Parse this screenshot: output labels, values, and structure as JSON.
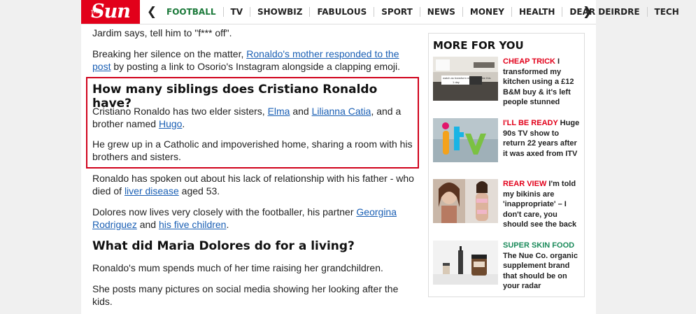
{
  "brand": {
    "logo_text": "Sun",
    "logo_small": "THE"
  },
  "nav": {
    "items": [
      "FOOTBALL",
      "TV",
      "SHOWBIZ",
      "FABULOUS",
      "SPORT",
      "NEWS",
      "MONEY",
      "HEALTH",
      "DEAR DEIRDRE",
      "TECH"
    ],
    "active_color": "#1c7a3b"
  },
  "article": {
    "p1": "Jardim says, tell him to \"f*** off\".",
    "p2": {
      "pre": "Breaking her silence on the matter, ",
      "link": "Ronaldo's mother responded to the post",
      "post": " by posting a link to Osorio's Instagram alongside a clapping emoji."
    },
    "h_siblings": "How many siblings does Cristiano Ronaldo have?",
    "p3": {
      "a": "Cristiano Ronaldo has two elder sisters, ",
      "link1": "Elma",
      "b": " and ",
      "link2": "Lilianna Catia",
      "c": ", and a brother named ",
      "link3": "Hugo",
      "d": "."
    },
    "p4": "He grew up in a Catholic and impoverished home, sharing a room with his brothers and sisters.",
    "p5": {
      "a": "Ronaldo has spoken out about his lack of relationship with his father - who died of ",
      "link": "liver disease",
      "b": " aged 53."
    },
    "p6": {
      "a": "Dolores now lives very closely with the footballer, his partner ",
      "link1": "Georgina Rodriguez",
      "b": " and ",
      "link2": "his five children",
      "c": "."
    },
    "h_living": "What did Maria Dolores do for a living?",
    "p7": "Ronaldo's mum spends much of her time raising her grandchildren.",
    "p8": "She posts many pictures on social media showing her looking after the kids."
  },
  "sidebar": {
    "title": "MORE FOR YOU",
    "cards": [
      {
        "kicker": "CHEAP TRICK",
        "kicker_color": "#e2001a",
        "text": " I transformed my kitchen using a £12 B&M buy & it's left people stunned",
        "thumb_icon": "kitchen-photo",
        "thumb_caption": "watch as transform my kitchen like this",
        "thumb_caption2": "1 day"
      },
      {
        "kicker": "I'LL BE READY",
        "kicker_color": "#e2001a",
        "text": " Huge 90s TV show to return 22 years after it was axed from ITV",
        "thumb_icon": "itv-logo"
      },
      {
        "kicker": "REAR VIEW",
        "kicker_color": "#e2001a",
        "text": " I'm told my bikinis are 'inappropriate' – I don't care, you should see the back",
        "thumb_icon": "bikini-photo"
      },
      {
        "kicker": "SUPER SKIN FOOD",
        "kicker_color": "#1a8a5a",
        "text": " The Nue Co. organic supplement brand that should be on your radar",
        "thumb_icon": "supplement-products"
      }
    ]
  },
  "colors": {
    "brand_red": "#e2001a",
    "link": "#1a5fb4",
    "highlight_border": "#d0021b"
  }
}
